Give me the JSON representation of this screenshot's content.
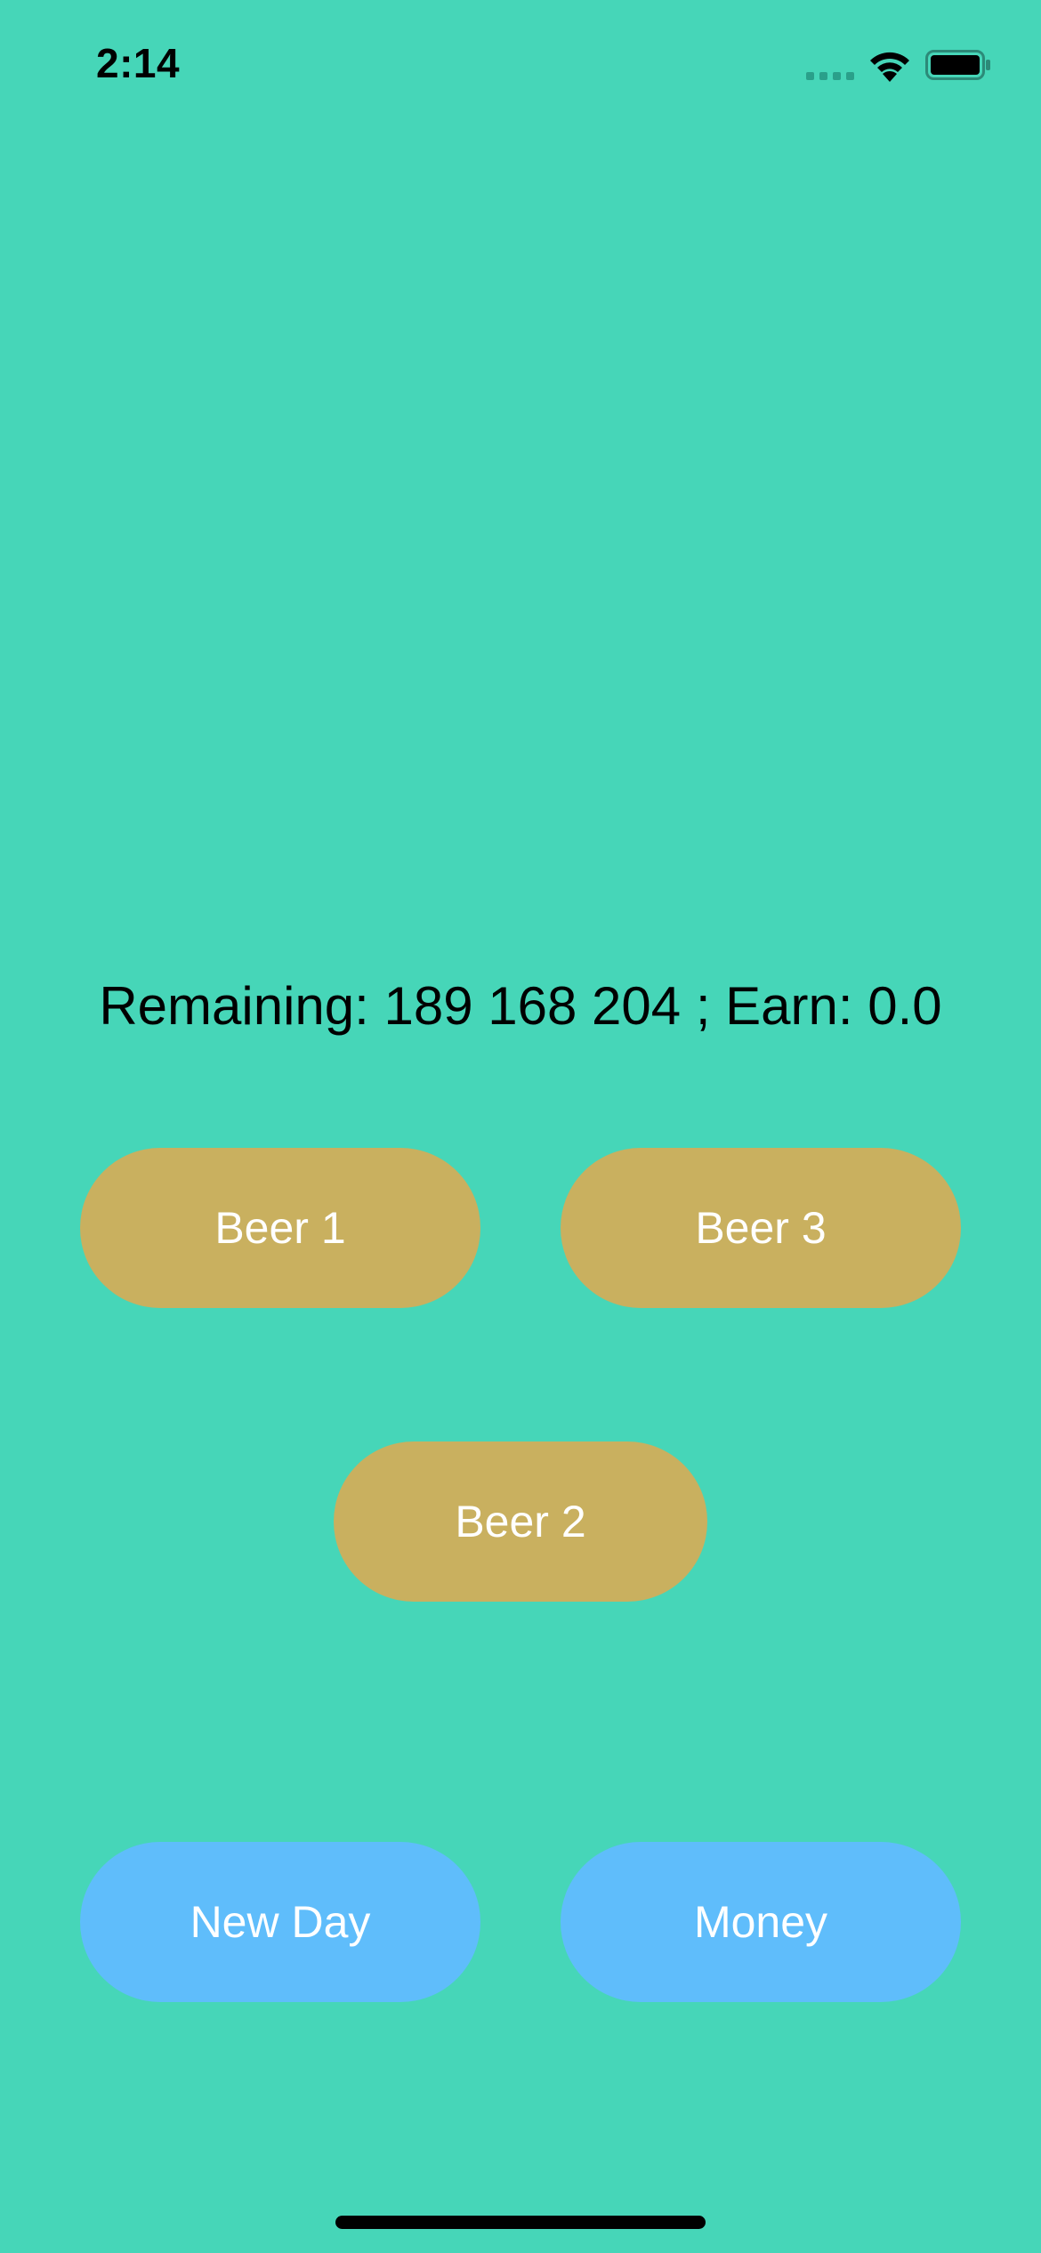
{
  "status_bar": {
    "time": "2:14",
    "signal_icon": "cellular-signal-icon",
    "wifi_icon": "wifi-icon",
    "battery_icon": "battery-icon",
    "battery_level": 1.0
  },
  "main": {
    "stats_text": "Remaining: 189 168 204 ; Earn: 0.0"
  },
  "beer_buttons": {
    "beer1_label": "Beer 1",
    "beer2_label": "Beer 2",
    "beer3_label": "Beer 3"
  },
  "actions": {
    "new_day_label": "New Day",
    "money_label": "Money"
  },
  "colors": {
    "background": "#46d6b8",
    "beer_button": "#c9b05f",
    "action_button": "#5fbdfb",
    "button_text": "#ffffff"
  }
}
